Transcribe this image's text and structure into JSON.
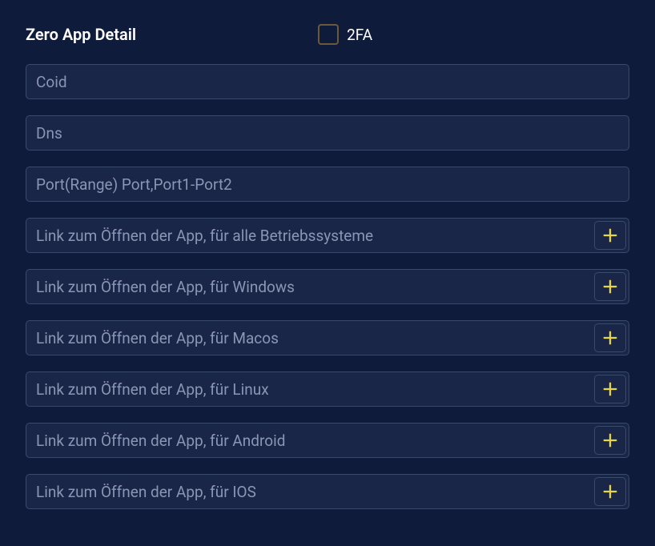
{
  "header": {
    "title": "Zero App Detail",
    "checkbox_label": "2FA"
  },
  "fields": {
    "coid": {
      "placeholder": "Coid",
      "value": ""
    },
    "dns": {
      "placeholder": "Dns",
      "value": ""
    },
    "port": {
      "placeholder": "Port(Range) Port,Port1-Port2",
      "value": ""
    },
    "link_all": {
      "placeholder": "Link zum Öffnen der App, für alle Betriebssysteme",
      "value": ""
    },
    "link_windows": {
      "placeholder": "Link zum Öffnen der App, für Windows",
      "value": ""
    },
    "link_macos": {
      "placeholder": "Link zum Öffnen der App, für Macos",
      "value": ""
    },
    "link_linux": {
      "placeholder": "Link zum Öffnen der App, für Linux",
      "value": ""
    },
    "link_android": {
      "placeholder": "Link zum Öffnen der App, für Android",
      "value": ""
    },
    "link_ios": {
      "placeholder": "Link zum Öffnen der App, für IOS",
      "value": ""
    }
  },
  "colors": {
    "accent": "#e8d445"
  }
}
